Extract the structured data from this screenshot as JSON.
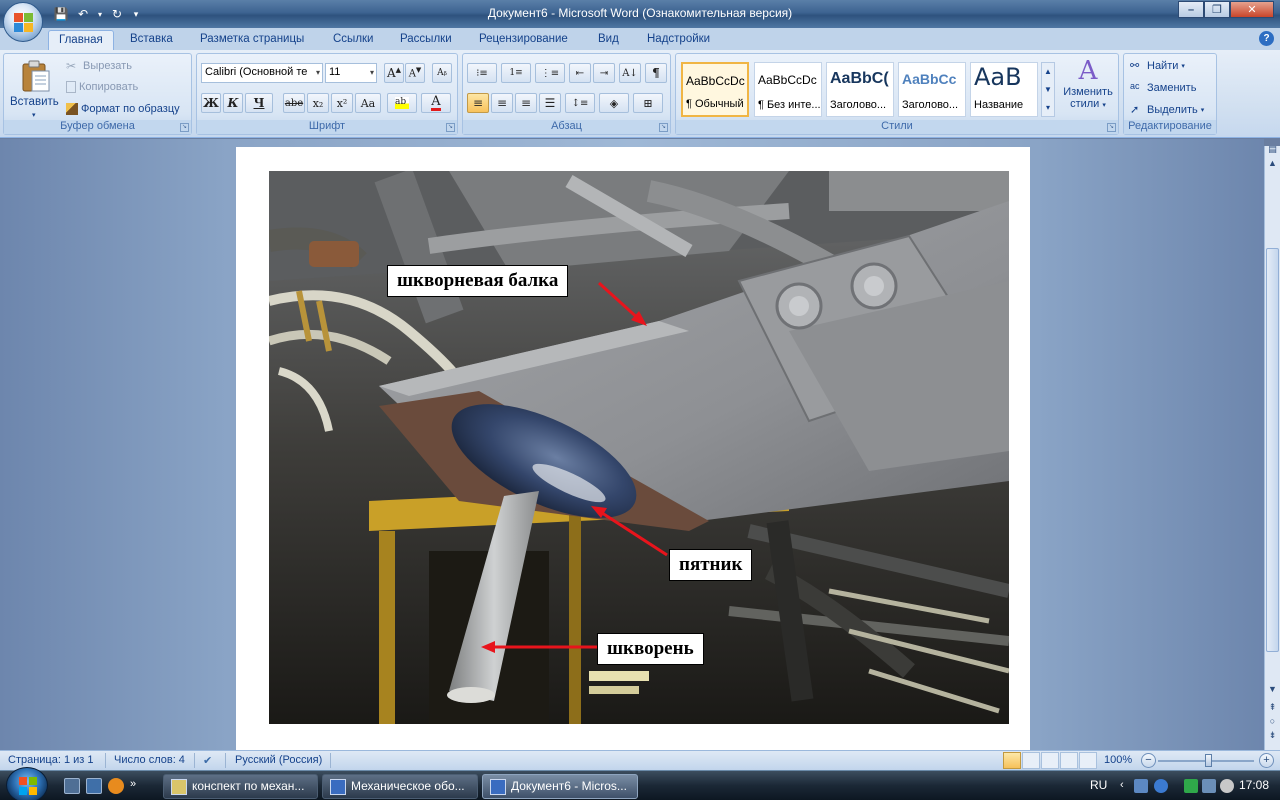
{
  "window": {
    "title": "Документ6 - Microsoft Word (Ознакомительная версия)"
  },
  "tabs": [
    "Главная",
    "Вставка",
    "Разметка страницы",
    "Ссылки",
    "Рассылки",
    "Рецензирование",
    "Вид",
    "Надстройки"
  ],
  "ribbon": {
    "clipboard": {
      "label": "Буфер обмена",
      "paste": "Вставить",
      "cut": "Вырезать",
      "copy": "Копировать",
      "format_painter": "Формат по образцу"
    },
    "font": {
      "label": "Шрифт",
      "font_name": "Calibri (Основной те",
      "font_size": "11",
      "bold": "Ж",
      "italic": "К",
      "underline": "Ч",
      "strike": "abe",
      "subscript": "x₂",
      "superscript": "x²",
      "change_case": "Aa"
    },
    "paragraph": {
      "label": "Абзац",
      "pilcrow": "¶"
    },
    "styles": {
      "label": "Стили",
      "items": [
        {
          "sample": "AaBbCcDc",
          "name": "¶ Обычный"
        },
        {
          "sample": "AaBbCcDc",
          "name": "¶ Без инте..."
        },
        {
          "sample": "AaBbC(",
          "name": "Заголово..."
        },
        {
          "sample": "AaBbCc",
          "name": "Заголово..."
        },
        {
          "sample": "AaB",
          "name": "Название"
        }
      ],
      "change_styles_1": "Изменить",
      "change_styles_2": "стили"
    },
    "editing": {
      "label": "Редактирование",
      "find": "Найти",
      "replace": "Заменить",
      "select": "Выделить"
    }
  },
  "document": {
    "labels": {
      "kingpin_beam": "шкворневая балка",
      "center_plate": "пятник",
      "kingpin": "шкворень"
    }
  },
  "statusbar": {
    "page": "Страница: 1 из 1",
    "words": "Число слов: 4",
    "language": "Русский (Россия)",
    "zoom": "100%"
  },
  "taskbar": {
    "tasks": [
      "конспект по механ...",
      "Механическое обо...",
      "Документ6 - Micros..."
    ],
    "lang": "RU",
    "time": "17:08"
  },
  "colors": {
    "accent_arrow": "#e8141c",
    "ribbon_blue": "#15428b"
  }
}
